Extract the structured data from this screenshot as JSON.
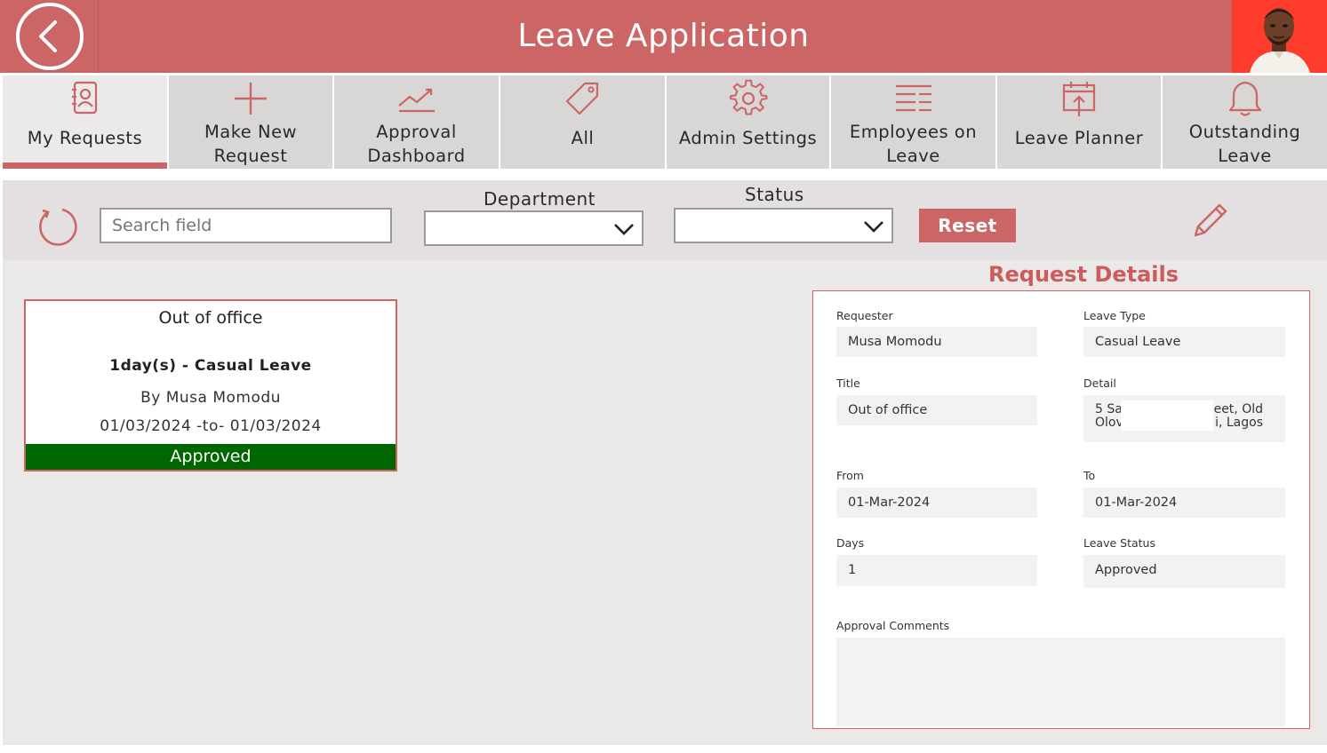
{
  "header": {
    "title": "Leave Application",
    "accent_color": "#cc6666"
  },
  "nav": {
    "tabs": [
      {
        "label_lines": [
          "My Requests"
        ],
        "icon": "contact-book-icon",
        "active": true
      },
      {
        "label_lines": [
          "Make New",
          "Request"
        ],
        "icon": "plus-icon"
      },
      {
        "label_lines": [
          "Approval",
          "Dashboard"
        ],
        "icon": "trend-chart-icon"
      },
      {
        "label_lines": [
          "All"
        ],
        "icon": "tag-icon"
      },
      {
        "label_lines": [
          "Admin Settings"
        ],
        "icon": "gear-icon"
      },
      {
        "label_lines": [
          "Employees on",
          "Leave"
        ],
        "icon": "list-icon"
      },
      {
        "label_lines": [
          "Leave Planner"
        ],
        "icon": "calendar-upload-icon"
      },
      {
        "label_lines": [
          "Outstanding",
          "Leave"
        ],
        "icon": "bell-icon"
      }
    ]
  },
  "filters": {
    "search_placeholder": "Search field",
    "department_label": "Department",
    "status_label": "Status",
    "reset_label": "Reset"
  },
  "card": {
    "title": "Out of office",
    "summary": "1day(s) - Casual Leave",
    "by": "By Musa Momodu",
    "dates": "01/03/2024 -to- 01/03/2024",
    "status": "Approved",
    "status_color": "#006600"
  },
  "details": {
    "heading": "Request Details",
    "requester_label": "Requester",
    "requester": "Musa Momodu",
    "leave_type_label": "Leave Type",
    "leave_type": "Casual Leave",
    "title_label": "Title",
    "title": "Out of office",
    "detail_label": "Detail",
    "detail_line1_left": "5 Sa",
    "detail_line1_right": "eet, Old",
    "detail_line2_left": "Olov",
    "detail_line2_right": "i, Lagos",
    "from_label": "From",
    "from": "01-Mar-2024",
    "to_label": "To",
    "to": "01-Mar-2024",
    "days_label": "Days",
    "days": "1",
    "leave_status_label": "Leave Status",
    "leave_status": "Approved",
    "approval_comments_label": "Approval Comments",
    "approval_comments": ""
  }
}
